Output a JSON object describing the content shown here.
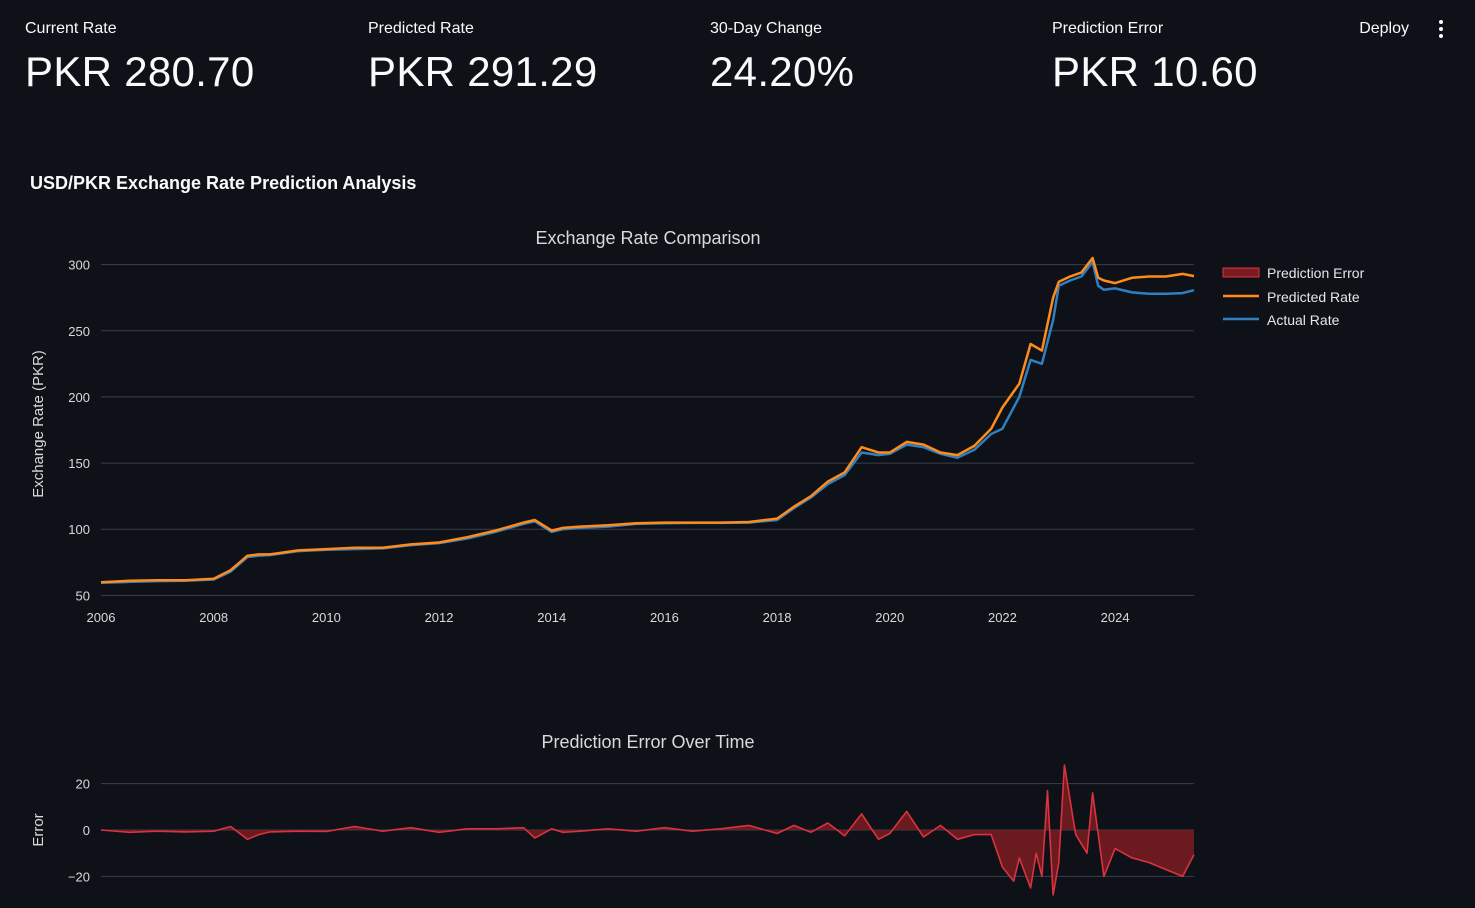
{
  "header": {
    "deploy_label": "Deploy",
    "menu_icon": "more-vertical-icon"
  },
  "metrics": [
    {
      "label": "Current Rate",
      "value": "PKR 280.70"
    },
    {
      "label": "Predicted Rate",
      "value": "PKR 291.29"
    },
    {
      "label": "30-Day Change",
      "value": "24.20%"
    },
    {
      "label": "Prediction Error",
      "value": "PKR 10.60"
    }
  ],
  "section_title": "USD/PKR Exchange Rate Prediction Analysis",
  "colors": {
    "background": "#0e1117",
    "predicted": "#ff8c1a",
    "actual": "#2f7fc1",
    "error_line": "#d9333f",
    "error_fill": "#7b1c22",
    "grid": "#3a3f4b"
  },
  "chart_data": [
    {
      "type": "line",
      "title": "Exchange Rate Comparison",
      "xlabel": "",
      "ylabel": "Exchange Rate (PKR)",
      "xlim": [
        2006.0,
        2025.4
      ],
      "ylim": [
        45,
        305
      ],
      "x_ticks": [
        2006,
        2008,
        2010,
        2012,
        2014,
        2016,
        2018,
        2020,
        2022,
        2024
      ],
      "x_tick_labels": [
        "2006",
        "2008",
        "2010",
        "2012",
        "2014",
        "2016",
        "2018",
        "2020",
        "2022",
        "2024"
      ],
      "y_ticks": [
        50,
        100,
        150,
        200,
        250,
        300
      ],
      "y_tick_labels": [
        "50",
        "100",
        "150",
        "200",
        "250",
        "300"
      ],
      "grid": "horizontal",
      "legend_position": "top-right",
      "legend": [
        "Prediction Error",
        "Predicted Rate",
        "Actual Rate"
      ],
      "x": [
        2006.0,
        2006.5,
        2007.0,
        2007.5,
        2008.0,
        2008.3,
        2008.6,
        2008.8,
        2009.0,
        2009.5,
        2010.0,
        2010.5,
        2011.0,
        2011.5,
        2012.0,
        2012.5,
        2013.0,
        2013.5,
        2013.7,
        2014.0,
        2014.2,
        2014.5,
        2015.0,
        2015.5,
        2016.0,
        2016.5,
        2017.0,
        2017.5,
        2018.0,
        2018.3,
        2018.6,
        2018.9,
        2019.2,
        2019.5,
        2019.8,
        2020.0,
        2020.3,
        2020.6,
        2020.9,
        2021.2,
        2021.5,
        2021.8,
        2022.0,
        2022.3,
        2022.5,
        2022.7,
        2022.9,
        2023.0,
        2023.2,
        2023.4,
        2023.6,
        2023.7,
        2023.8,
        2024.0,
        2024.3,
        2024.6,
        2024.9,
        2025.2,
        2025.4
      ],
      "series": [
        {
          "name": "Actual Rate",
          "values": [
            59.5,
            60.2,
            60.8,
            61.0,
            62.0,
            68.0,
            79.0,
            80.0,
            80.5,
            83.5,
            84.5,
            85.0,
            85.5,
            88.0,
            89.5,
            93.0,
            98.0,
            104.0,
            106.0,
            98.0,
            100.0,
            101.0,
            102.0,
            104.0,
            104.5,
            104.8,
            104.8,
            105.0,
            107.0,
            116.0,
            124.0,
            134.0,
            141.0,
            158.0,
            156.0,
            157.0,
            164.0,
            162.0,
            157.0,
            154.0,
            160.0,
            172.0,
            176.0,
            200.0,
            228.0,
            225.0,
            258.0,
            284.0,
            288.0,
            291.0,
            302.0,
            284.0,
            281.0,
            282.0,
            279.0,
            278.0,
            278.0,
            278.5,
            280.7
          ]
        },
        {
          "name": "Predicted Rate",
          "values": [
            60.0,
            61.0,
            61.5,
            61.5,
            62.5,
            69.0,
            80.0,
            81.0,
            81.0,
            84.0,
            85.0,
            86.0,
            86.0,
            88.5,
            90.0,
            94.0,
            99.0,
            105.0,
            107.0,
            99.0,
            101.0,
            102.0,
            103.0,
            104.5,
            105.0,
            105.0,
            105.0,
            105.5,
            108.0,
            117.0,
            125.0,
            136.0,
            143.0,
            162.0,
            158.0,
            158.0,
            166.0,
            164.0,
            158.0,
            156.0,
            163.0,
            176.0,
            192.0,
            210.0,
            240.0,
            235.0,
            275.0,
            287.0,
            291.0,
            294.0,
            305.0,
            290.0,
            288.0,
            286.0,
            290.0,
            291.0,
            291.0,
            293.0,
            291.3
          ]
        }
      ]
    },
    {
      "type": "area",
      "title": "Prediction Error Over Time",
      "xlabel": "",
      "ylabel": "Error",
      "xlim": [
        2006.0,
        2025.4
      ],
      "ylim": [
        -28,
        28
      ],
      "y_ticks": [
        -20,
        0,
        20
      ],
      "y_tick_labels": [
        "−20",
        "0",
        "20"
      ],
      "grid": "horizontal",
      "x": [
        2006.0,
        2006.5,
        2007.0,
        2007.5,
        2008.0,
        2008.3,
        2008.6,
        2008.8,
        2009.0,
        2009.5,
        2010.0,
        2010.5,
        2011.0,
        2011.5,
        2012.0,
        2012.5,
        2013.0,
        2013.5,
        2013.7,
        2014.0,
        2014.2,
        2014.5,
        2015.0,
        2015.5,
        2016.0,
        2016.5,
        2017.0,
        2017.5,
        2018.0,
        2018.3,
        2018.6,
        2018.9,
        2019.2,
        2019.5,
        2019.8,
        2020.0,
        2020.3,
        2020.6,
        2020.9,
        2021.2,
        2021.5,
        2021.8,
        2022.0,
        2022.2,
        2022.3,
        2022.5,
        2022.6,
        2022.7,
        2022.8,
        2022.9,
        2023.0,
        2023.1,
        2023.3,
        2023.5,
        2023.6,
        2023.8,
        2024.0,
        2024.3,
        2024.6,
        2024.9,
        2025.2,
        2025.4
      ],
      "series": [
        {
          "name": "Prediction Error",
          "values": [
            0.0,
            -1.0,
            -0.5,
            -0.8,
            -0.5,
            1.5,
            -4.0,
            -2.0,
            -0.8,
            -0.5,
            -0.6,
            1.5,
            -0.5,
            1.0,
            -1.0,
            0.5,
            0.5,
            1.0,
            -3.5,
            0.5,
            -1.0,
            -0.5,
            0.5,
            -0.5,
            1.0,
            -0.5,
            0.5,
            2.0,
            -1.5,
            2.0,
            -1.0,
            3.0,
            -2.5,
            7.0,
            -4.0,
            -1.5,
            8.0,
            -3.0,
            2.0,
            -4.0,
            -2.0,
            -2.0,
            -16.0,
            -22.0,
            -12.0,
            -25.0,
            -10.0,
            -20.0,
            17.0,
            -28.0,
            -14.0,
            28.0,
            -2.0,
            -10.0,
            16.0,
            -20.0,
            -8.0,
            -12.0,
            -14.0,
            -17.0,
            -20.0,
            -10.6
          ]
        }
      ]
    }
  ]
}
